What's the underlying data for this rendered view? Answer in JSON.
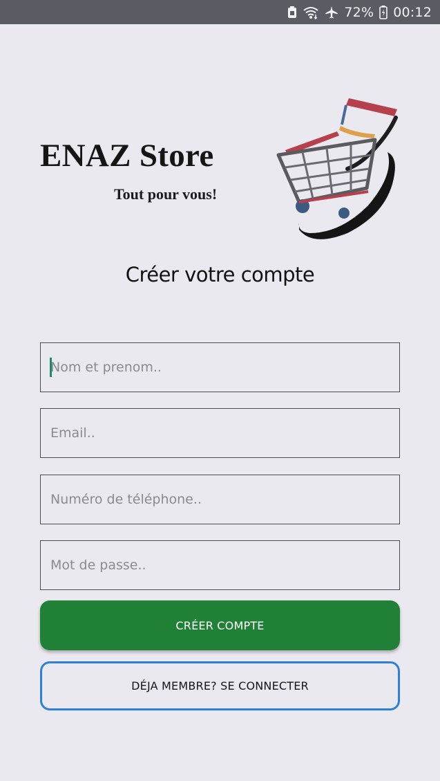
{
  "status_bar": {
    "battery_percent": "72%",
    "time": "00:12",
    "icons": [
      "notification-icon",
      "wifi-icon",
      "airplane-icon",
      "battery-icon"
    ]
  },
  "brand": {
    "name": "ENAZ Store",
    "tagline": "Tout pour vous!",
    "logo_icon": "shopping-cart-icon"
  },
  "form": {
    "title": "Créer votre compte",
    "fields": [
      {
        "name": "name",
        "placeholder": "Nom et prenom..",
        "value": ""
      },
      {
        "name": "email",
        "placeholder": "Email..",
        "value": ""
      },
      {
        "name": "phone",
        "placeholder": "Numéro de téléphone..",
        "value": ""
      },
      {
        "name": "password",
        "placeholder": "Mot de passe..",
        "value": ""
      }
    ],
    "submit_label": "CRÉER COMPTE",
    "login_label": "DÉJA MEMBRE? SE CONNECTER"
  },
  "colors": {
    "status_bar": "#5b5b63",
    "background": "#eae9ef",
    "primary_button": "#208036",
    "secondary_border": "#2f7fd8",
    "caret": "#1c8a6c"
  }
}
